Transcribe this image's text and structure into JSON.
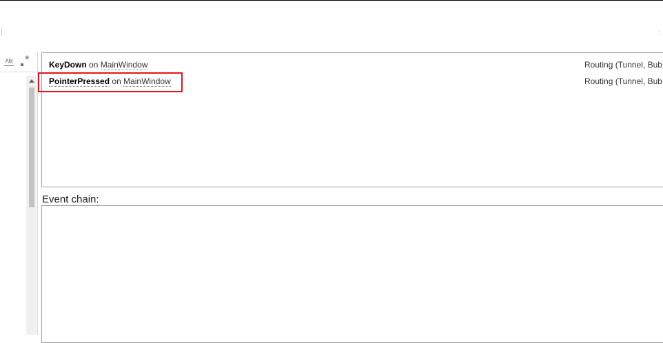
{
  "filters": {
    "match_case_icon": "ab-text-icon",
    "match_case_text": "Ab|",
    "regex_icon": "regex-icon"
  },
  "events": [
    {
      "name": "KeyDown",
      "connector": "on",
      "source": "MainWindow",
      "routing": "Routing (Tunnel, Bub"
    },
    {
      "name": "PointerPressed",
      "connector": "on",
      "source": "MainWindow",
      "routing": "Routing (Tunnel, Bub"
    }
  ],
  "event_chain": {
    "label": "Event chain:"
  },
  "colors": {
    "highlight": "#e0141e",
    "border": "#a0a0a0"
  }
}
